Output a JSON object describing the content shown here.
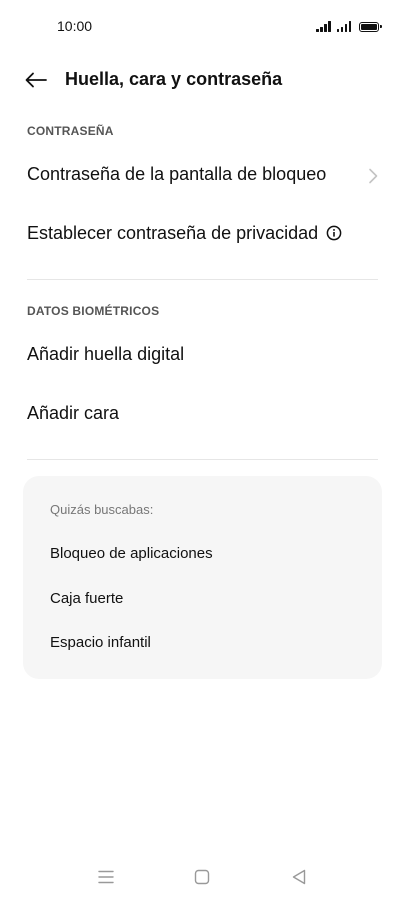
{
  "status_bar": {
    "time": "10:00",
    "icons": [
      "signal-icon",
      "signal-icon",
      "battery-icon"
    ]
  },
  "header": {
    "back_icon": "arrow-left-icon",
    "title": "Huella, cara y contraseña"
  },
  "sections": {
    "password": {
      "header": "CONTRASEÑA",
      "items": [
        {
          "label": "Contraseña de la pantalla de bloqueo",
          "icon": "chevron-right-icon"
        },
        {
          "label": "Establecer contraseña de privacidad",
          "icon": "info-icon"
        }
      ]
    },
    "biometrics": {
      "header": "DATOS BIOMÉTRICOS",
      "items": [
        {
          "label": "Añadir huella digital"
        },
        {
          "label": "Añadir cara"
        }
      ]
    }
  },
  "suggestions": {
    "title": "Quizás buscabas:",
    "items": [
      {
        "label": "Bloqueo de aplicaciones"
      },
      {
        "label": "Caja fuerte"
      },
      {
        "label": "Espacio infantil"
      }
    ]
  },
  "nav_bar": {
    "icons": [
      "menu-icon",
      "home-icon",
      "back-triangle-icon"
    ]
  },
  "colors": {
    "text": "#111111",
    "section_header": "#555555",
    "divider": "#e6e6e6",
    "card_background": "#f6f6f6",
    "muted": "#777777"
  }
}
